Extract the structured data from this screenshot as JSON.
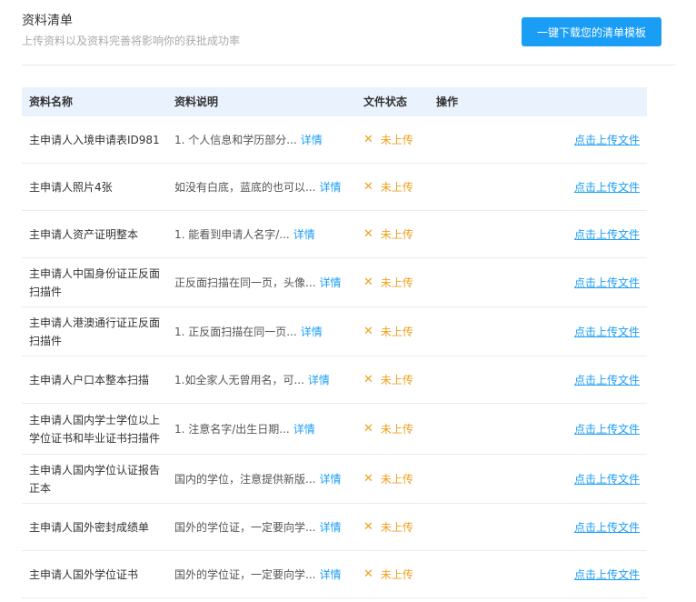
{
  "header": {
    "title": "资料清单",
    "subtitle": "上传资料以及资料完善将影响你的获批成功率",
    "download_label": "一键下载您的清单模板"
  },
  "table": {
    "columns": [
      "资料名称",
      "资料说明",
      "文件状态",
      "操作"
    ],
    "detail_label": "详情",
    "status_icon": "close-icon",
    "rows": [
      {
        "name": "主申请人入境申请表ID981",
        "desc": "1. 个人信息和学历部分...",
        "status": "未上传",
        "action": "点击上传文件"
      },
      {
        "name": "主申请人照片4张",
        "desc": "如没有白底，蓝底的也可以...",
        "status": "未上传",
        "action": "点击上传文件"
      },
      {
        "name": "主申请人资产证明整本",
        "desc": "1. 能看到申请人名字/...",
        "status": "未上传",
        "action": "点击上传文件"
      },
      {
        "name": "主申请人中国身份证正反面扫描件",
        "desc": "正反面扫描在同一页，头像...",
        "status": "未上传",
        "action": "点击上传文件"
      },
      {
        "name": "主申请人港澳通行证正反面扫描件",
        "desc": "1. 正反面扫描在同一页...",
        "status": "未上传",
        "action": "点击上传文件"
      },
      {
        "name": "主申请人户口本整本扫描",
        "desc": "1.如全家人无曾用名，可...",
        "status": "未上传",
        "action": "点击上传文件"
      },
      {
        "name": "主申请人国内学士学位以上学位证书和毕业证书扫描件",
        "desc": "1. 注意名字/出生日期...",
        "status": "未上传",
        "action": "点击上传文件"
      },
      {
        "name": "主申请人国内学位认证报告正本",
        "desc": "国内的学位，注意提供新版...",
        "status": "未上传",
        "action": "点击上传文件"
      },
      {
        "name": "主申请人国外密封成绩单",
        "desc": "国外的学位证，一定要向学...",
        "status": "未上传",
        "action": "点击上传文件"
      },
      {
        "name": "主申请人国外学位证书",
        "desc": "国外的学位证，一定要向学...",
        "status": "未上传",
        "action": "点击上传文件"
      }
    ]
  }
}
